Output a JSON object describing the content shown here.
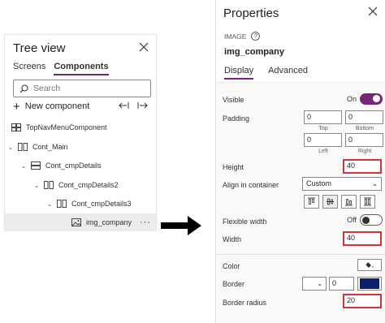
{
  "tree": {
    "title": "Tree view",
    "tabs": [
      "Screens",
      "Components"
    ],
    "search_placeholder": "Search",
    "new_component": "New component",
    "rows": [
      {
        "label": "TopNavMenuComponent",
        "type": "component"
      },
      {
        "label": "Cont_Main",
        "type": "container"
      },
      {
        "label": "Cont_cmpDetails",
        "type": "container-h"
      },
      {
        "label": "Cont_cmpDetails2",
        "type": "container"
      },
      {
        "label": "Cont_cmpDetails3",
        "type": "container"
      },
      {
        "label": "img_company",
        "type": "image",
        "more": "···"
      }
    ]
  },
  "props": {
    "title": "Properties",
    "type_label": "IMAGE",
    "help": "?",
    "name": "img_company",
    "tabs": [
      "Display",
      "Advanced"
    ],
    "visible": {
      "label": "Visible",
      "state": "On"
    },
    "padding": {
      "label": "Padding",
      "top": "0",
      "bottom": "0",
      "left": "0",
      "right": "0",
      "sub": [
        "Top",
        "Bottom",
        "Left",
        "Right"
      ]
    },
    "height": {
      "label": "Height",
      "value": "40"
    },
    "align": {
      "label": "Align in container",
      "value": "Custom"
    },
    "flexible_width": {
      "label": "Flexible width",
      "state": "Off"
    },
    "width": {
      "label": "Width",
      "value": "40"
    },
    "color": {
      "label": "Color",
      "icon": "paint-bucket-icon"
    },
    "border": {
      "label": "Border",
      "width": "0",
      "color": "#0b1f6e"
    },
    "border_radius": {
      "label": "Border radius",
      "value": "20"
    }
  },
  "colors": {
    "accent": "#742774",
    "highlight": "#d13438"
  }
}
